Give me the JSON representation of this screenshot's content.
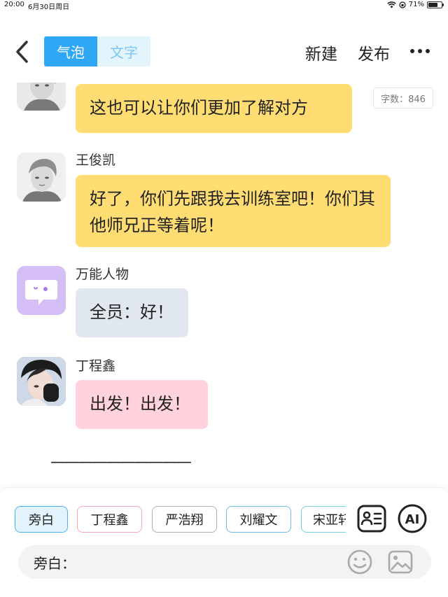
{
  "status_bar": {
    "time": "20:00",
    "date": "6月30日周日",
    "battery_text": "71%",
    "battery_level": 0.71
  },
  "header": {
    "tabs": [
      {
        "label": "气泡",
        "active": true
      },
      {
        "label": "文字",
        "active": false
      }
    ],
    "new_label": "新建",
    "publish_label": "发布",
    "accent_color": "#2ea8f6"
  },
  "word_count": "字数：846",
  "messages": [
    {
      "speaker": "",
      "text": "这也可以让你们更加了解对方",
      "color": "#ffdd73"
    },
    {
      "speaker": "王俊凯",
      "text": "好了，你们先跟我去训练室吧！你们其他师兄正等着呢！",
      "color": "#ffdd73"
    },
    {
      "speaker": "万能人物",
      "text": "全员：好！",
      "color": "#e1e7ef"
    },
    {
      "speaker": "丁程鑫",
      "text": "出发！出发！",
      "color": "#ffd2dc"
    }
  ],
  "divider_text": "——————————",
  "characters": [
    {
      "name": "旁白",
      "active": true
    },
    {
      "name": "丁程鑫",
      "active": false
    },
    {
      "name": "严浩翔",
      "active": false
    },
    {
      "name": "刘耀文",
      "active": false
    },
    {
      "name": "宋亚轩",
      "active": false
    }
  ],
  "tools": {
    "ai_label": "AI"
  },
  "input": {
    "label": "旁白：",
    "value": ""
  }
}
